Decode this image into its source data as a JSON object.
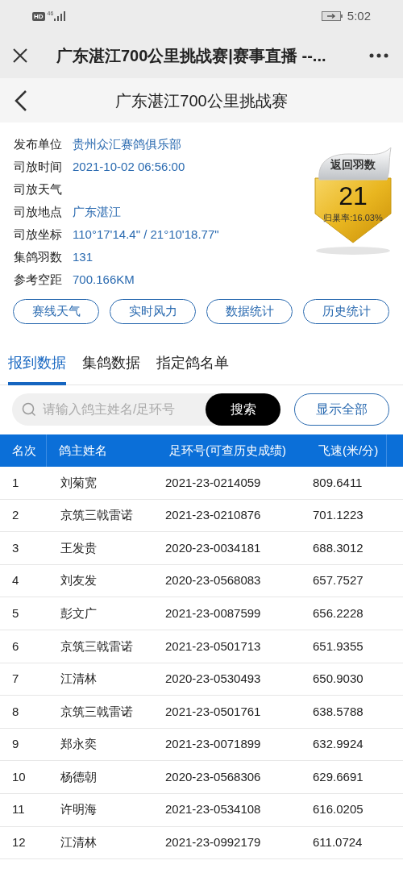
{
  "status_bar": {
    "hd": "HD",
    "network": "46",
    "time": "5:02"
  },
  "browser_bar": {
    "title": "广东湛江700公里挑战赛|赛事直播 --..."
  },
  "header": {
    "title": "广东湛江700公里挑战赛"
  },
  "info": [
    {
      "label": "发布单位",
      "value": "贵州众汇赛鸽俱乐部"
    },
    {
      "label": "司放时间",
      "value": "2021-10-02 06:56:00"
    },
    {
      "label": "司放天气"
    },
    {
      "label": "司放地点",
      "value": "广东湛江"
    },
    {
      "label": "司放坐标",
      "value": "110°17'14.4\" / 21°10'18.77\""
    },
    {
      "label": "集鸽羽数",
      "value": "131"
    },
    {
      "label": "参考空距",
      "value": "700.166KM"
    }
  ],
  "badge": {
    "title": "返回羽数",
    "count": "21",
    "rate": "归巢率:16.03%"
  },
  "actions": [
    "赛线天气",
    "实时风力",
    "数据统计",
    "历史统计"
  ],
  "tabs": [
    {
      "label": "报到数据",
      "selected": true
    },
    {
      "label": "集鸽数据",
      "selected": false
    },
    {
      "label": "指定鸽名单",
      "selected": false
    }
  ],
  "search": {
    "placeholder": "请输入鸽主姓名/足环号",
    "button": "搜索",
    "show_all": "显示全部"
  },
  "table": {
    "columns": [
      "名次",
      "鸽主姓名",
      "足环号(可查历史成绩)",
      "飞速(米/分)"
    ],
    "rows": [
      [
        "1",
        "刘菊宽",
        "2021-23-0214059",
        "809.6411"
      ],
      [
        "2",
        "京筑三戟雷诺",
        "2021-23-0210876",
        "701.1223"
      ],
      [
        "3",
        "王发贵",
        "2020-23-0034181",
        "688.3012"
      ],
      [
        "4",
        "刘友发",
        "2020-23-0568083",
        "657.7527"
      ],
      [
        "5",
        "彭文广",
        "2021-23-0087599",
        "656.2228"
      ],
      [
        "6",
        "京筑三戟雷诺",
        "2021-23-0501713",
        "651.9355"
      ],
      [
        "7",
        "江清林",
        "2020-23-0530493",
        "650.9030"
      ],
      [
        "8",
        "京筑三戟雷诺",
        "2021-23-0501761",
        "638.5788"
      ],
      [
        "9",
        "郑永奕",
        "2021-23-0071899",
        "632.9924"
      ],
      [
        "10",
        "杨德朝",
        "2020-23-0568306",
        "629.6691"
      ],
      [
        "11",
        "许明海",
        "2021-23-0534108",
        "616.0205"
      ],
      [
        "12",
        "江清林",
        "2021-23-0992179",
        "611.0724"
      ]
    ]
  }
}
